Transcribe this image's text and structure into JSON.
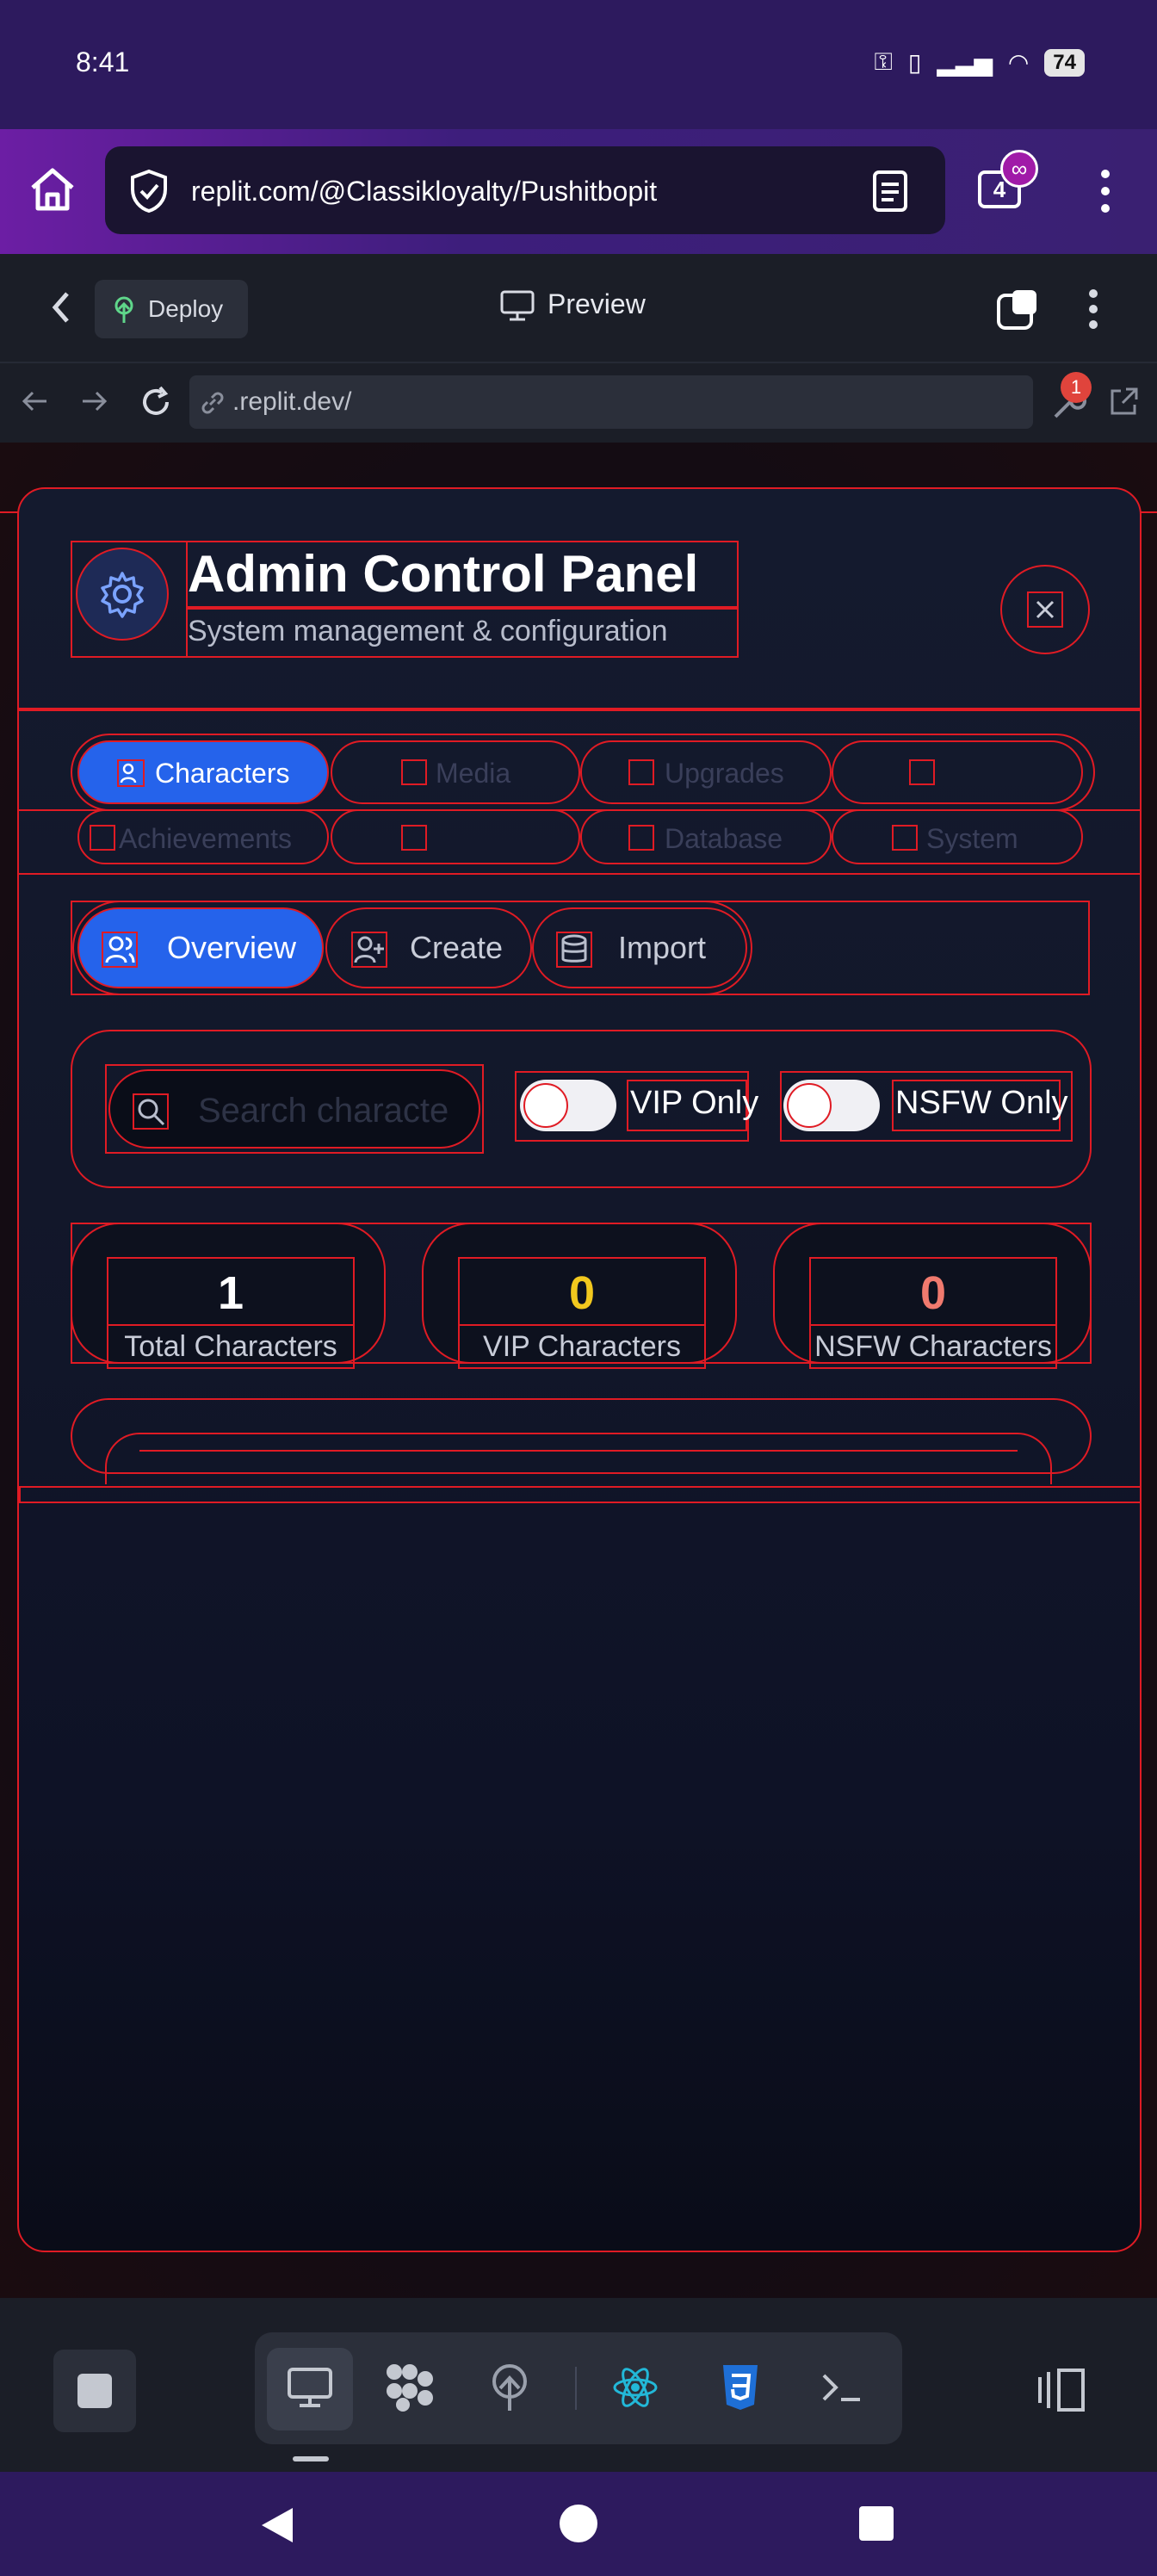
{
  "status_bar": {
    "time": "8:41",
    "battery": "74"
  },
  "browser": {
    "url": "replit.com/@Classikloyalty/Pushitbopit",
    "tab_count": "4",
    "tab_badge": "∞"
  },
  "replit_header": {
    "deploy_label": "Deploy",
    "preview_label": "Preview"
  },
  "replit_urlbar": {
    "url": ".replit.dev/",
    "notification_count": "1"
  },
  "panel": {
    "title": "Admin Control Panel",
    "subtitle": "System management & configuration",
    "main_tabs": [
      {
        "label": "Characters",
        "active": true
      },
      {
        "label": "Media",
        "active": false
      },
      {
        "label": "Upgrades",
        "active": false
      },
      {
        "label": "",
        "active": false
      },
      {
        "label": "Achievements",
        "active": false
      },
      {
        "label": "",
        "active": false
      },
      {
        "label": "Database",
        "active": false
      },
      {
        "label": "System",
        "active": false
      }
    ],
    "sub_tabs": [
      {
        "label": "Overview",
        "active": true
      },
      {
        "label": "Create",
        "active": false
      },
      {
        "label": "Import",
        "active": false
      }
    ],
    "search_placeholder": "Search characte",
    "filters": {
      "vip_label": "VIP Only",
      "nsfw_label": "NSFW Only"
    },
    "stats": [
      {
        "value": "1",
        "label": "Total Characters",
        "color": "#ffffff"
      },
      {
        "value": "0",
        "label": "VIP Characters",
        "color": "#f2c81e"
      },
      {
        "value": "0",
        "label": "NSFW Characters",
        "color": "#f07a6e"
      }
    ]
  },
  "colors": {
    "accent": "#2563eb",
    "outline": "#e01b24",
    "brand_purple": "#2d1a5e"
  }
}
